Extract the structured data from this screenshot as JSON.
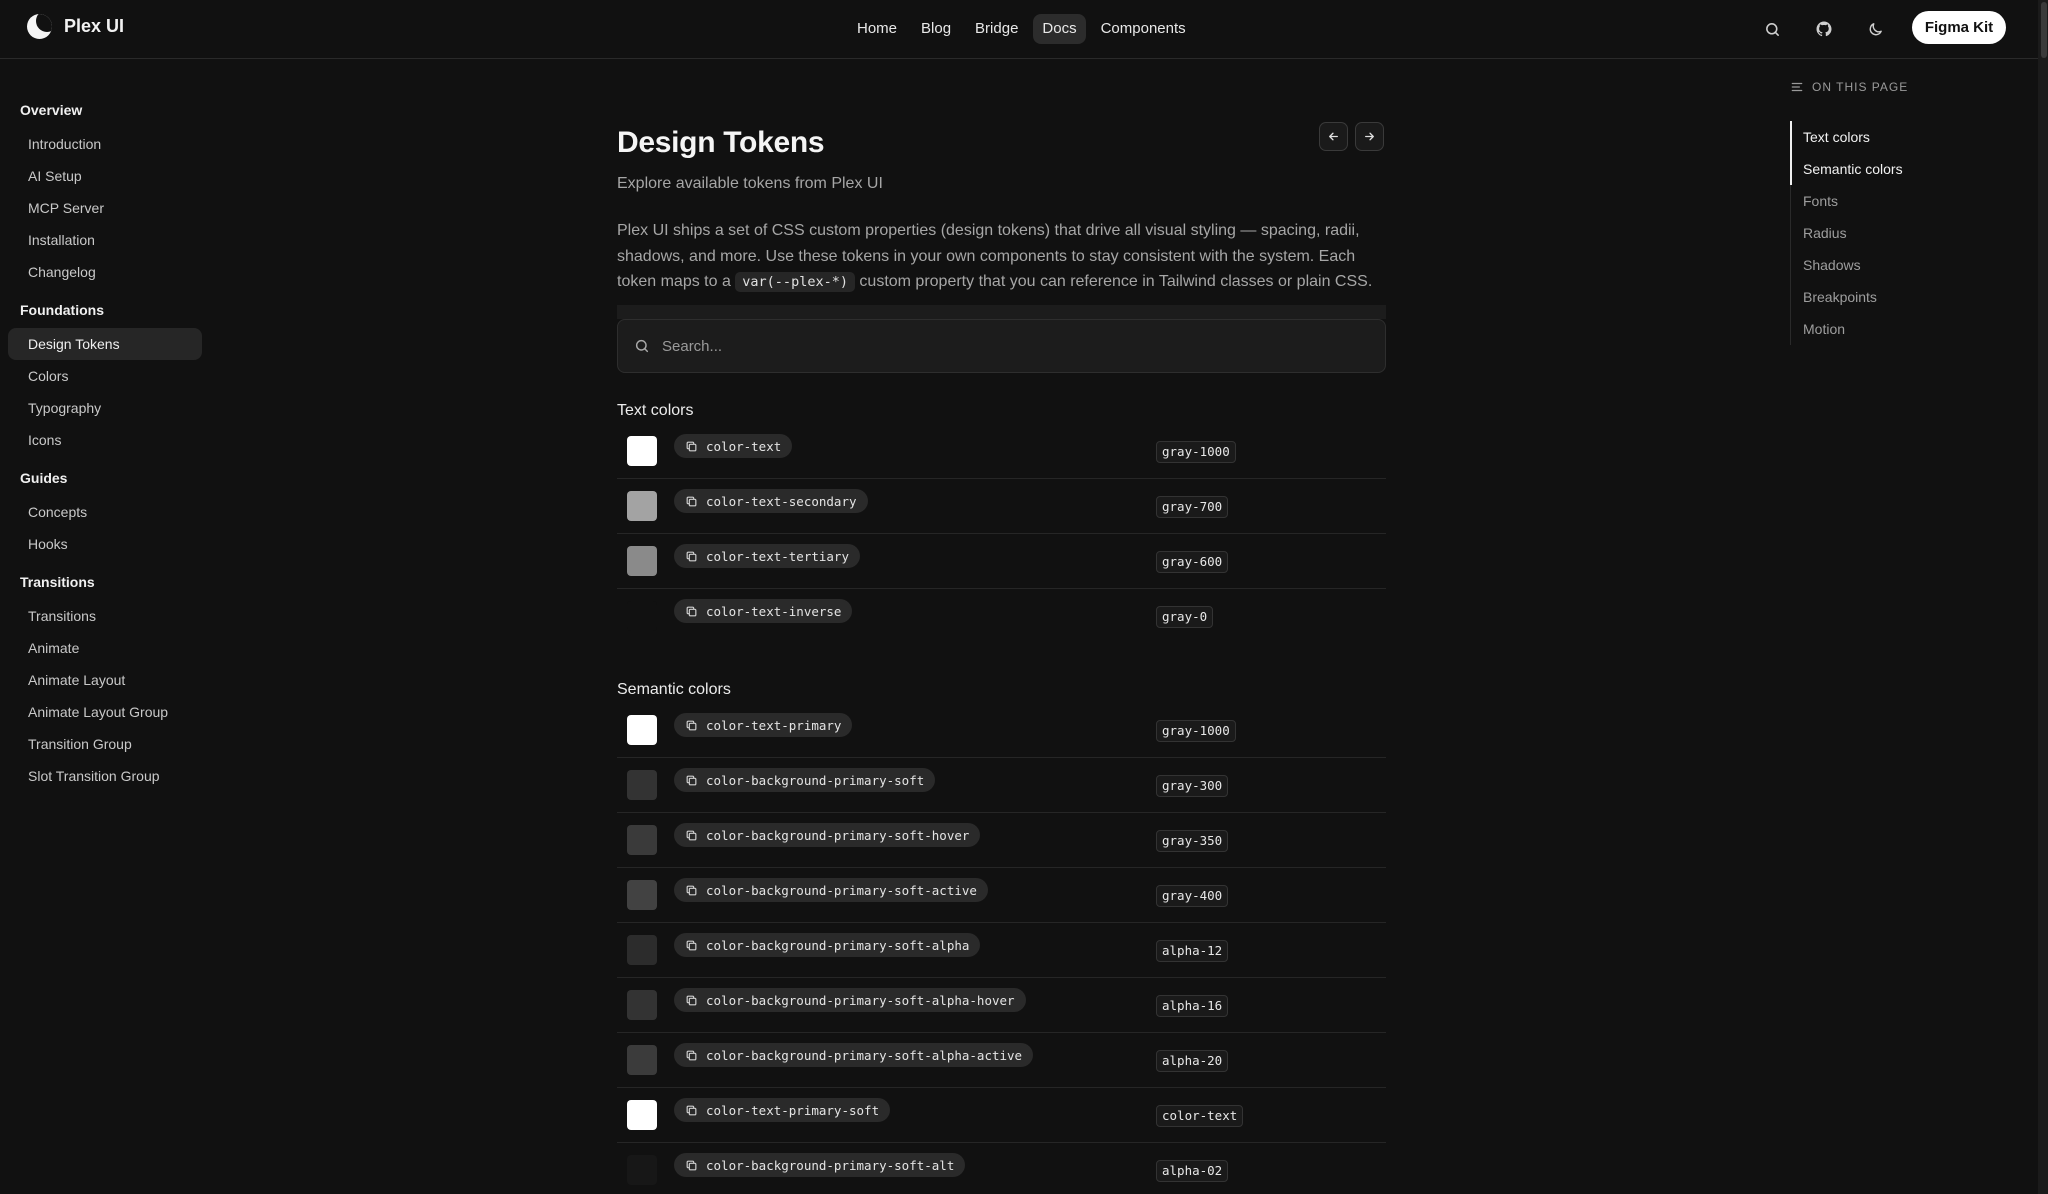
{
  "header": {
    "brand": "Plex UI",
    "nav": [
      {
        "label": "Home",
        "active": false
      },
      {
        "label": "Blog",
        "active": false
      },
      {
        "label": "Bridge",
        "active": false
      },
      {
        "label": "Docs",
        "active": true
      },
      {
        "label": "Components",
        "active": false
      }
    ],
    "icons": [
      "search-icon",
      "github-icon",
      "moon-icon"
    ],
    "cta_label": "Figma Kit"
  },
  "sidebar": {
    "sections": [
      {
        "title": "Overview",
        "items": [
          "Introduction",
          "AI Setup",
          "MCP Server",
          "Installation",
          "Changelog"
        ]
      },
      {
        "title": "Foundations",
        "items": [
          "Design Tokens",
          "Colors",
          "Typography",
          "Icons"
        ]
      },
      {
        "title": "Guides",
        "items": [
          "Concepts",
          "Hooks"
        ]
      },
      {
        "title": "Transitions",
        "items": [
          "Transitions",
          "Animate",
          "Animate Layout",
          "Animate Layout Group",
          "Transition Group",
          "Slot Transition Group"
        ]
      }
    ],
    "active_item": "Design Tokens"
  },
  "main": {
    "title": "Design Tokens",
    "subtitle": "Explore available tokens from Plex UI",
    "intro_before": "Plex UI ships a set of CSS custom properties (design tokens) that drive all visual styling — spacing, radii, shadows, and more. Use these tokens in your own components to stay consistent with the system. Each token maps to a ",
    "intro_code": "var(--plex-*)",
    "intro_after": " custom property that you can reference in Tailwind classes or plain CSS.",
    "search_placeholder": "Search...",
    "groups": [
      {
        "title": "Text colors",
        "tokens": [
          {
            "name": "color-text",
            "value": "gray-1000",
            "swatch": "#ffffff"
          },
          {
            "name": "color-text-secondary",
            "value": "gray-700",
            "swatch": "#a3a3a3"
          },
          {
            "name": "color-text-tertiary",
            "value": "gray-600",
            "swatch": "#8a8a8a"
          },
          {
            "name": "color-text-inverse",
            "value": "gray-0",
            "swatch": "#111111"
          }
        ]
      },
      {
        "title": "Semantic colors",
        "tokens": [
          {
            "name": "color-text-primary",
            "value": "gray-1000",
            "swatch": "#ffffff"
          },
          {
            "name": "color-background-primary-soft",
            "value": "gray-300",
            "swatch": "#333333"
          },
          {
            "name": "color-background-primary-soft-hover",
            "value": "gray-350",
            "swatch": "#3a3a3a"
          },
          {
            "name": "color-background-primary-soft-active",
            "value": "gray-400",
            "swatch": "#424242"
          },
          {
            "name": "color-background-primary-soft-alpha",
            "value": "alpha-12",
            "swatch": "#2c2c2c"
          },
          {
            "name": "color-background-primary-soft-alpha-hover",
            "value": "alpha-16",
            "swatch": "#333333"
          },
          {
            "name": "color-background-primary-soft-alpha-active",
            "value": "alpha-20",
            "swatch": "#3b3b3b"
          },
          {
            "name": "color-text-primary-soft",
            "value": "color-text",
            "swatch": "#ffffff"
          },
          {
            "name": "color-background-primary-soft-alt",
            "value": "alpha-02",
            "swatch": "#171717"
          }
        ]
      }
    ]
  },
  "toc": {
    "heading": "ON THIS PAGE",
    "items": [
      "Text colors",
      "Semantic colors",
      "Fonts",
      "Radius",
      "Shadows",
      "Breakpoints",
      "Motion"
    ],
    "active": [
      "Text colors",
      "Semantic colors"
    ]
  },
  "colors": {
    "background": "#111111",
    "accent": "#ffffff",
    "muted_text": "#a6a6a6"
  }
}
